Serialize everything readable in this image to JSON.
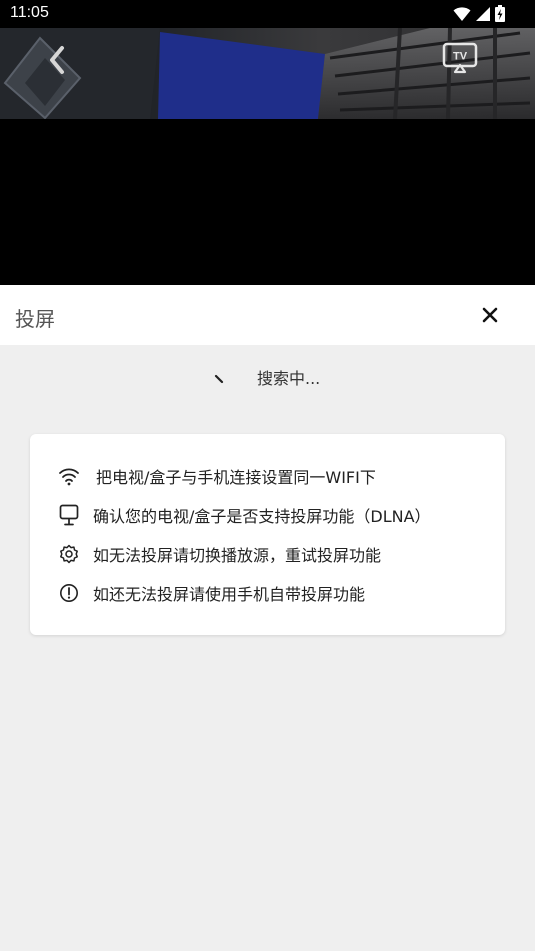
{
  "status_bar": {
    "time": "11:05",
    "icons": [
      "wifi-icon",
      "signal-icon",
      "battery-charging-icon"
    ]
  },
  "player": {
    "back_icon": "chevron-left-icon",
    "cast_icon": "tv-cast-icon",
    "cast_icon_label": "TV"
  },
  "cast_panel": {
    "title": "投屏",
    "close_icon": "close-icon",
    "status_spinner": "、",
    "status_text": "搜索中..."
  },
  "tips": [
    {
      "icon": "wifi-icon",
      "text": "把电视/盒子与手机连接设置同一WIFI下"
    },
    {
      "icon": "monitor-icon",
      "text": "确认您的电视/盒子是否支持投屏功能（DLNA）"
    },
    {
      "icon": "gear-icon",
      "text": "如无法投屏请切换播放源，重试投屏功能"
    },
    {
      "icon": "info-circle-icon",
      "text": "如还无法投屏请使用手机自带投屏功能"
    }
  ],
  "colors": {
    "panel_background": "#efefef",
    "header_background": "#ffffff",
    "status_bar": "#000000"
  }
}
